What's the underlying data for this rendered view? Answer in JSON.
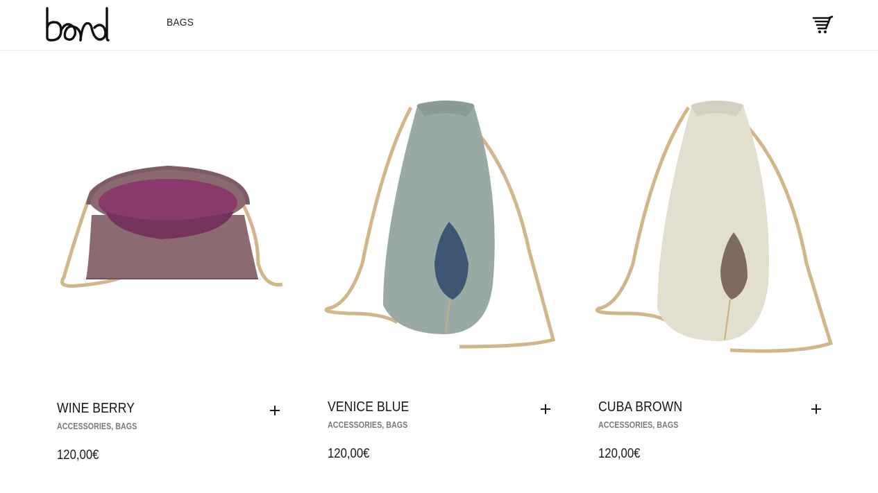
{
  "header": {
    "logo_text": "bond",
    "nav": [
      {
        "label": "BAGS"
      }
    ],
    "cart_icon": "cart-icon"
  },
  "products": [
    {
      "title": "WINE BERRY",
      "categories": [
        "ACCESSORIES",
        "BAGS"
      ],
      "separator": ", ",
      "price": "120,00€",
      "colors": {
        "fabric": "#8c6a72",
        "lining": "#8a3a6a",
        "rope": "#d2b68a"
      }
    },
    {
      "title": "VENICE BLUE",
      "categories": [
        "ACCESSORIES",
        "BAGS"
      ],
      "separator": ", ",
      "price": "120,00€",
      "colors": {
        "fabric": "#98aaa3",
        "lining": "#3e5672",
        "rope": "#d2b68a"
      }
    },
    {
      "title": "CUBA BROWN",
      "categories": [
        "ACCESSORIES",
        "BAGS"
      ],
      "separator": ", ",
      "price": "120,00€",
      "colors": {
        "fabric": "#e2dfcf",
        "lining": "#7e6b5c",
        "rope": "#d2b68a"
      }
    }
  ]
}
